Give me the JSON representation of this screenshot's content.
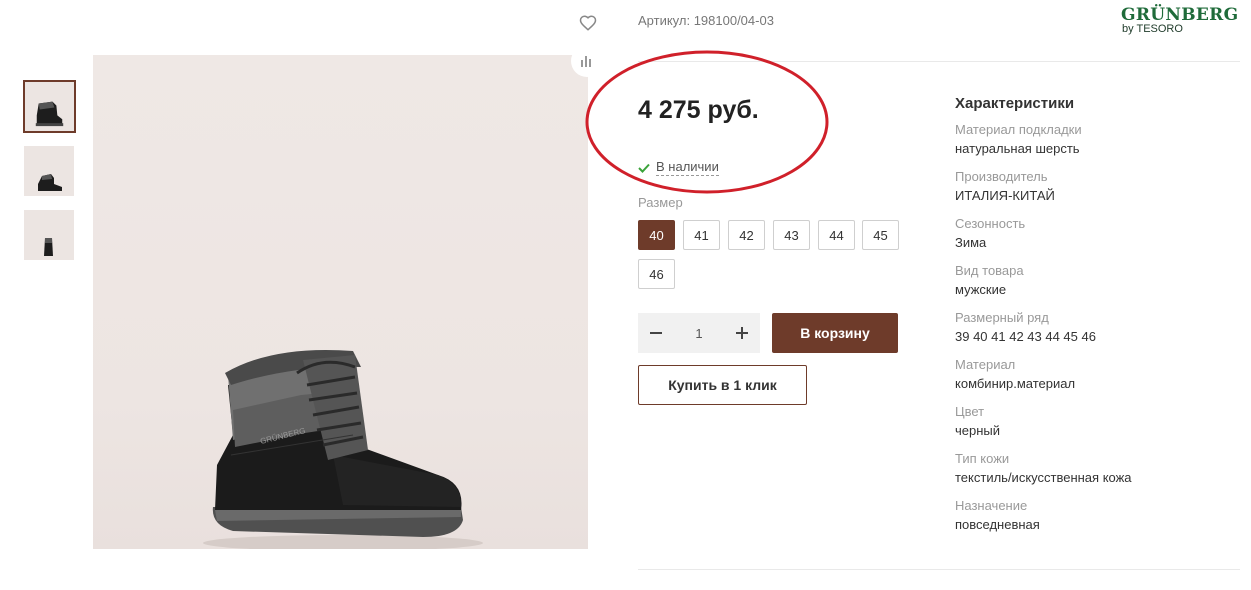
{
  "sku_text": "Артикул: 198100/04-03",
  "logo": {
    "name": "GRÜNBERG",
    "sub": "by TESORO"
  },
  "price": "4 275 руб.",
  "stock": "В наличии",
  "size_label": "Размер",
  "sizes": [
    "40",
    "41",
    "42",
    "43",
    "44",
    "45",
    "46"
  ],
  "selected_size": "40",
  "quantity": "1",
  "cart_label": "В корзину",
  "oneclick_label": "Купить в 1 клик",
  "specs_title": "Характеристики",
  "specs": [
    {
      "name": "Материал подкладки",
      "value": "натуральная шерсть"
    },
    {
      "name": "Производитель",
      "value": "ИТАЛИЯ-КИТАЙ"
    },
    {
      "name": "Сезонность",
      "value": "Зима"
    },
    {
      "name": "Вид товара",
      "value": "мужские"
    },
    {
      "name": "Размерный ряд",
      "value": "39 40 41 42 43 44 45 46"
    },
    {
      "name": "Материал",
      "value": "комбинир.материал"
    },
    {
      "name": "Цвет",
      "value": "черный"
    },
    {
      "name": "Тип кожи",
      "value": "текстиль/искусственная кожа"
    },
    {
      "name": "Назначение",
      "value": "повседневная"
    }
  ],
  "boot_brand_text": "GRÜNBERG",
  "icons": [
    "heart-icon",
    "stats-icon",
    "check-icon",
    "minus-icon",
    "plus-icon"
  ],
  "colors": {
    "accent": "#6e3b2a",
    "annotation": "#d0202a",
    "stock_check": "#3aa33a",
    "logo": "#1f6b3a"
  }
}
